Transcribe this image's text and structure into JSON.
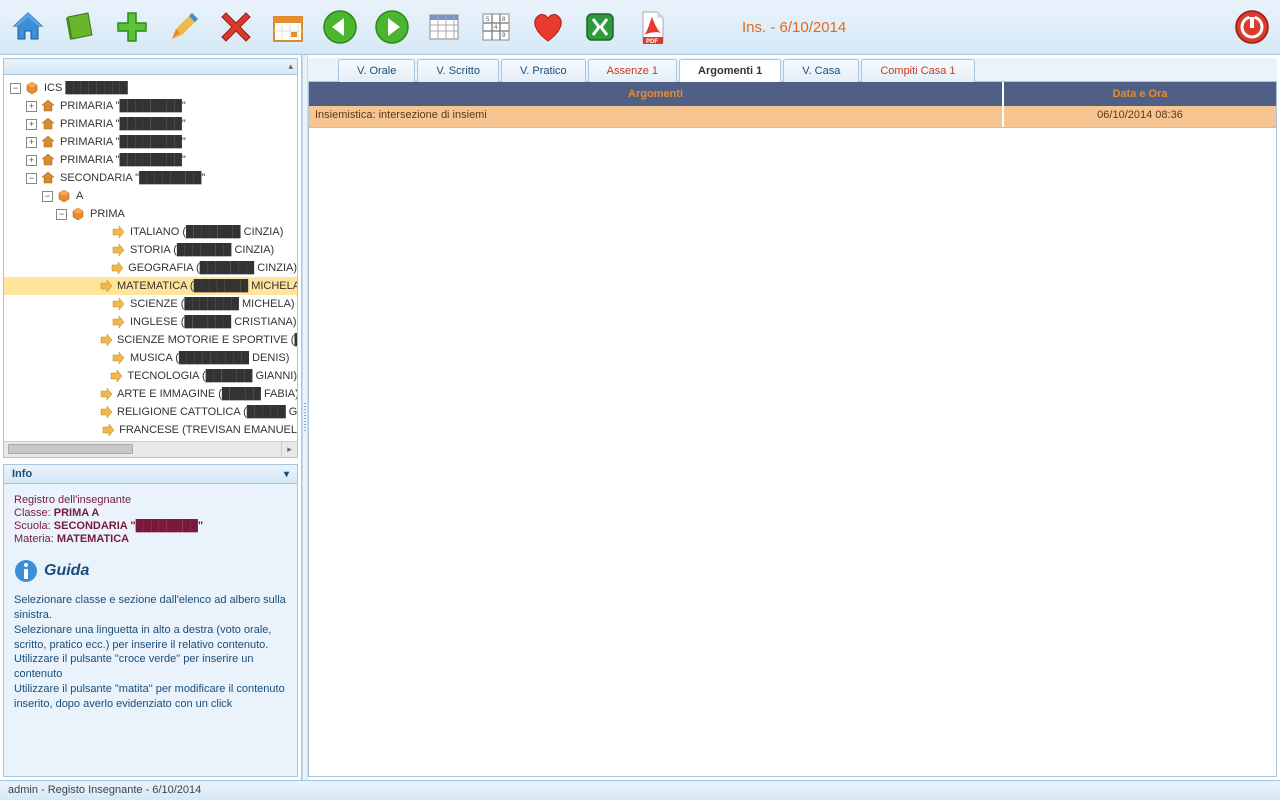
{
  "toolbar": {
    "label": "Ins. - 6/10/2014"
  },
  "tree": {
    "root": "ICS",
    "schools": [
      {
        "name": "PRIMARIA",
        "detail": "████████"
      },
      {
        "name": "PRIMARIA",
        "detail": "████████"
      },
      {
        "name": "PRIMARIA",
        "detail": "████████"
      },
      {
        "name": "PRIMARIA",
        "detail": "████████"
      },
      {
        "name": "SECONDARIA",
        "detail": "████████"
      }
    ],
    "section": "A",
    "class": "PRIMA",
    "subjects": [
      "ITALIANO (███████ CINZIA)",
      "STORIA (███████ CINZIA)",
      "GEOGRAFIA (███████ CINZIA)",
      "MATEMATICA (███████ MICHELA)",
      "SCIENZE (███████ MICHELA)",
      "INGLESE (██████ CRISTIANA)",
      "SCIENZE MOTORIE E SPORTIVE (█",
      "MUSICA (█████████ DENIS)",
      "TECNOLOGIA (██████ GIANNI)",
      "ARTE E IMMAGINE (█████ FABIA)",
      "RELIGIONE CATTOLICA (█████ G",
      "FRANCESE (TREVISAN EMANUEL"
    ],
    "selected_index": 3
  },
  "info": {
    "title": "Info",
    "registry": "Registro dell'insegnante",
    "class_label": "Classe:",
    "class": "PRIMA A",
    "school_label": "Scuola:",
    "school": "SECONDARIA \"████████\"",
    "subject_label": "Materia:",
    "subject": "MATEMATICA",
    "guide_title": "Guida",
    "guide_p1": "Selezionare classe e sezione dall'elenco ad albero sulla sinistra.",
    "guide_p2": "Selezionare una linguetta in alto a destra (voto orale, scritto, pratico ecc.) per inserire il relativo contenuto.",
    "guide_p3": "Utilizzare il pulsante \"croce verde\" per inserire un contenuto",
    "guide_p4": "Utilizzare il pulsante \"matita\" per modificare il contenuto inserito, dopo averlo evidenziato con un click"
  },
  "tabs": [
    {
      "label": "V. Orale",
      "style": ""
    },
    {
      "label": "V. Scritto",
      "style": ""
    },
    {
      "label": "V. Pratico",
      "style": ""
    },
    {
      "label": "Assenze 1",
      "style": "red"
    },
    {
      "label": "Argomenti 1",
      "style": "active"
    },
    {
      "label": "V. Casa",
      "style": ""
    },
    {
      "label": "Compiti Casa 1",
      "style": "red"
    }
  ],
  "grid": {
    "headers": {
      "arg": "Argomenti",
      "date": "Data e Ora"
    },
    "rows": [
      {
        "arg": "Insiemistica: intersezione di insiemi",
        "date": "06/10/2014 08:36"
      }
    ]
  },
  "statusbar": "admin - Registo Insegnante - 6/10/2014"
}
